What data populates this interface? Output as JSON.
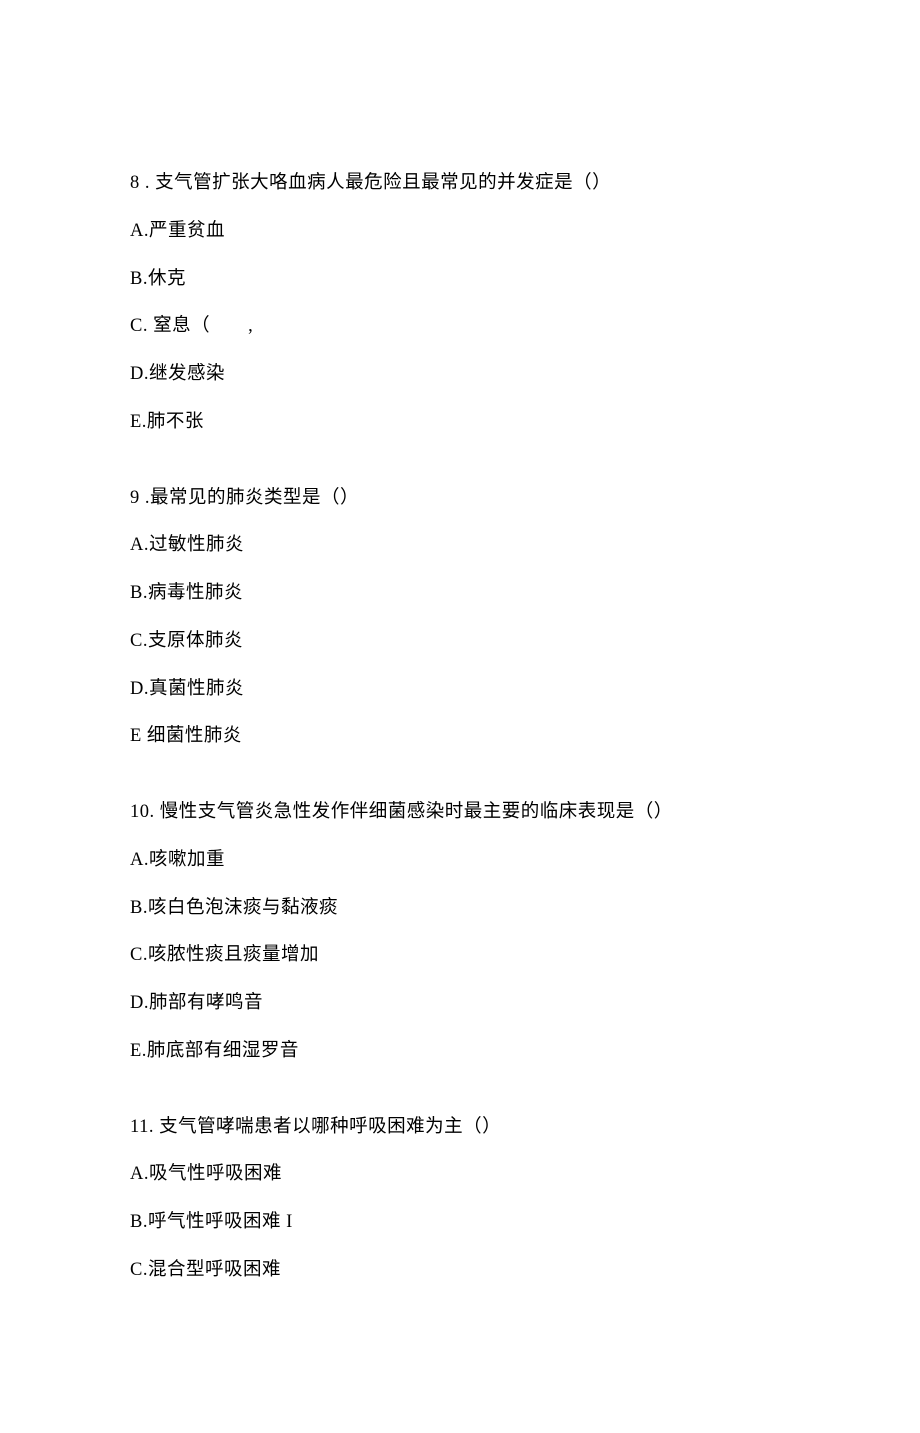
{
  "questions": [
    {
      "number": "8",
      "stem": " . 支气管扩张大咯血病人最危险且最常见的并发症是（）",
      "options": [
        "A.严重贫血",
        "B.休克",
        "C. 窒息（　　,",
        "D.继发感染",
        "E.肺不张"
      ]
    },
    {
      "number": "9",
      "stem": " .最常见的肺炎类型是（）",
      "options": [
        "A.过敏性肺炎",
        "B.病毒性肺炎",
        "C.支原体肺炎",
        "D.真菌性肺炎",
        "E 细菌性肺炎"
      ]
    },
    {
      "number": "10.",
      "stem": " 慢性支气管炎急性发作伴细菌感染时最主要的临床表现是（）",
      "options": [
        "A.咳嗽加重",
        "B.咳白色泡沫痰与黏液痰",
        "C.咳脓性痰且痰量增加",
        "D.肺部有哮鸣音",
        "E.肺底部有细湿罗音"
      ]
    },
    {
      "number": "11.",
      "stem": " 支气管哮喘患者以哪种呼吸困难为主（）",
      "options": [
        "A.吸气性呼吸困难",
        "B.呼气性呼吸困难 I",
        "C.混合型呼吸困难"
      ]
    }
  ]
}
